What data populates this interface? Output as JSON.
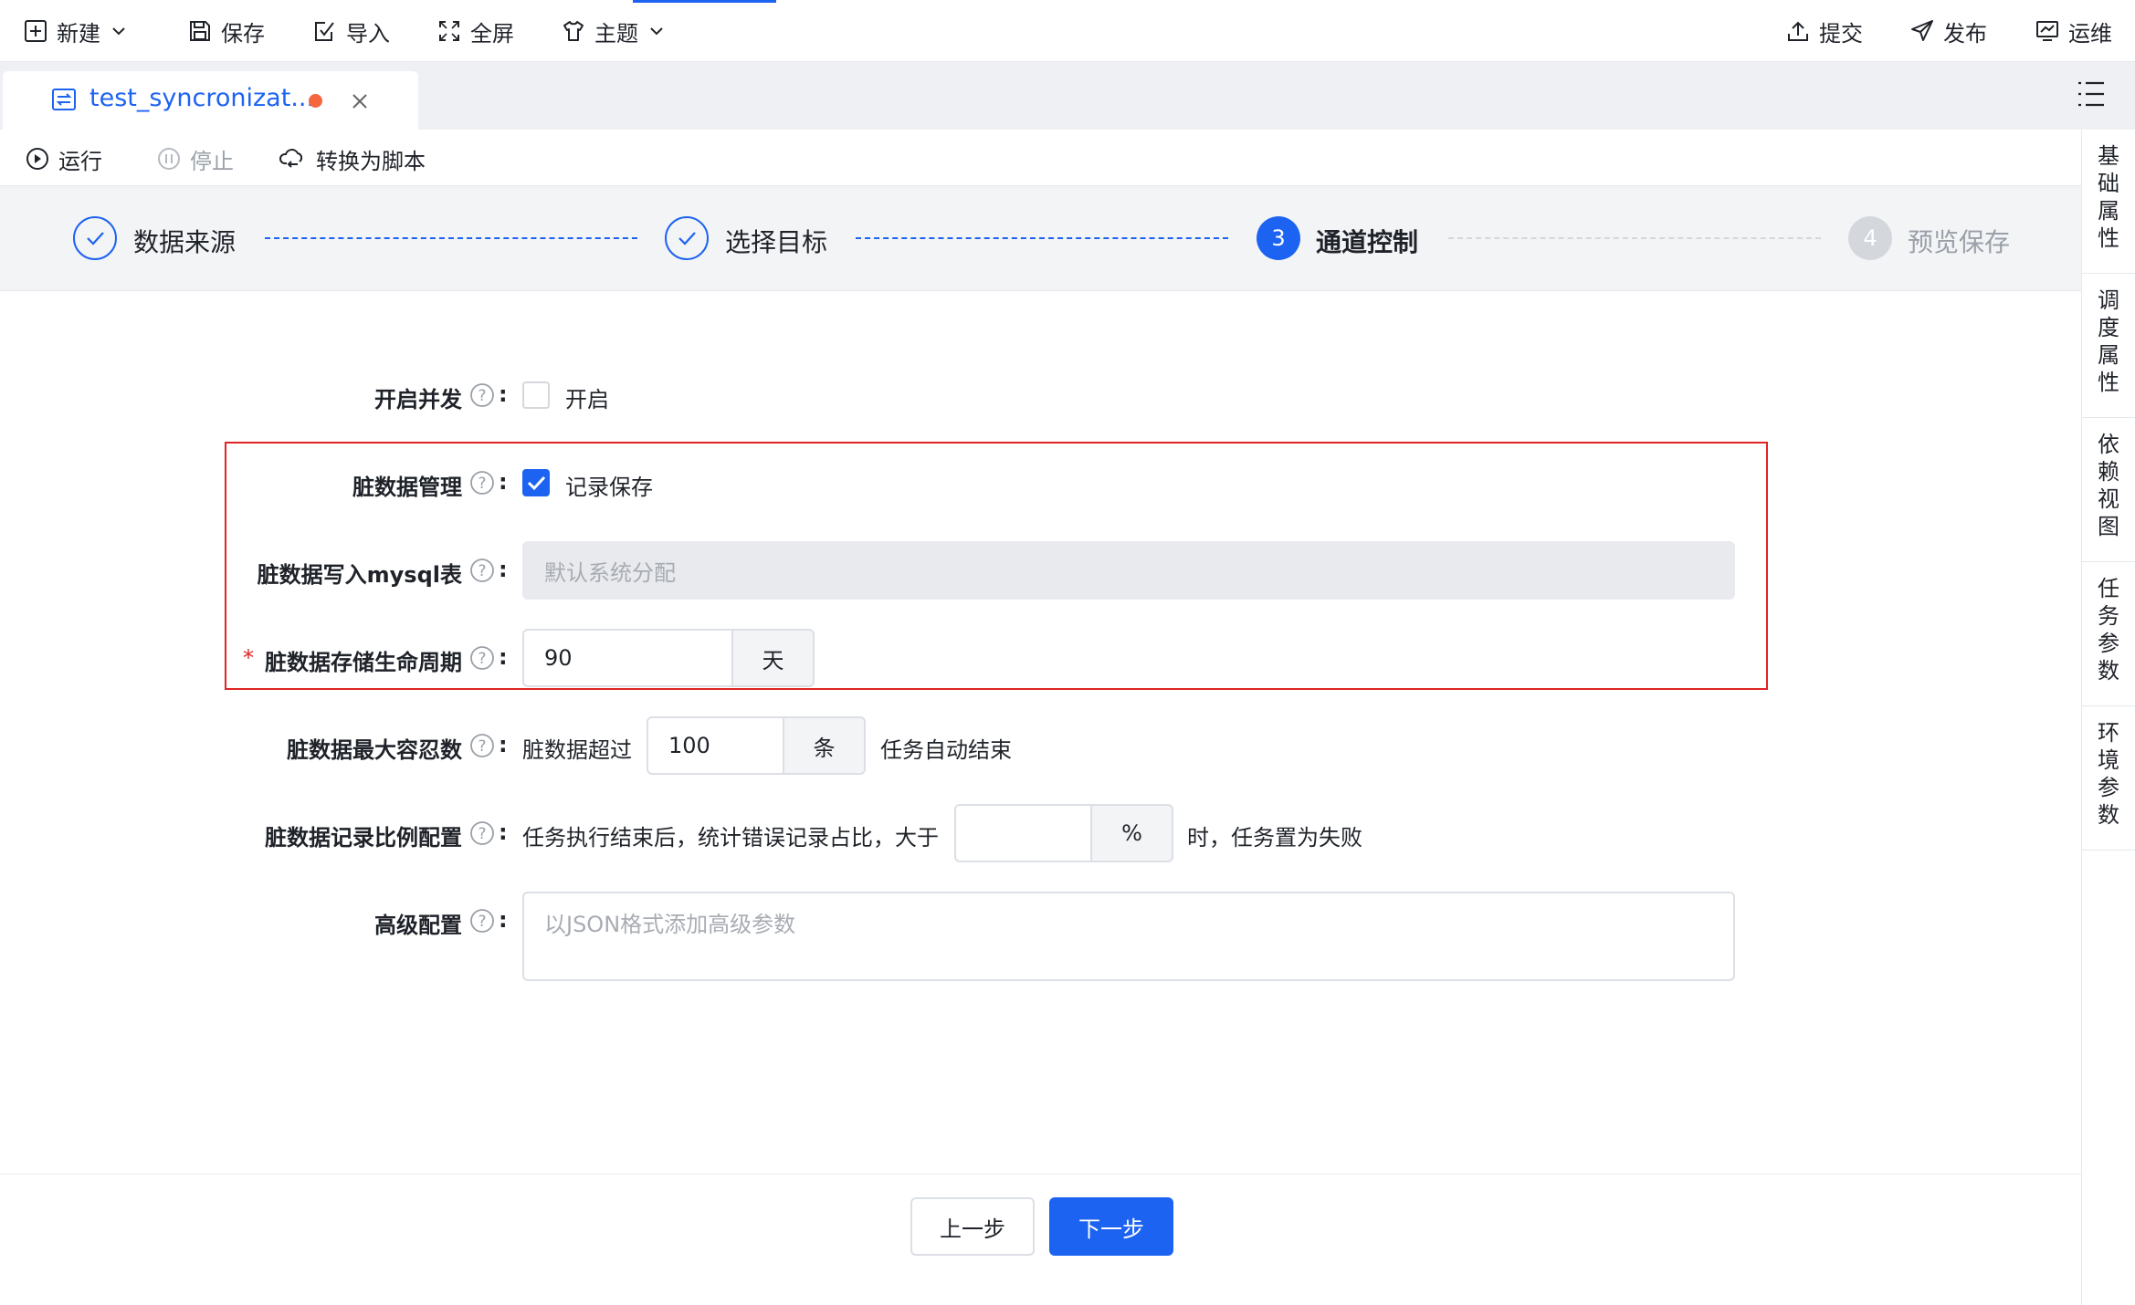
{
  "toolbar": {
    "new_label": "新建",
    "save_label": "保存",
    "import_label": "导入",
    "fullscreen_label": "全屏",
    "theme_label": "主题",
    "submit_label": "提交",
    "publish_label": "发布",
    "ops_label": "运维"
  },
  "tab": {
    "title": "test_syncronizat..."
  },
  "actions": {
    "run_label": "运行",
    "stop_label": "停止",
    "convert_label": "转换为脚本"
  },
  "steps": [
    {
      "number": "1",
      "label": "数据来源",
      "status": "done"
    },
    {
      "number": "2",
      "label": "选择目标",
      "status": "done"
    },
    {
      "number": "3",
      "label": "通道控制",
      "status": "active"
    },
    {
      "number": "4",
      "label": "预览保存",
      "status": "pending"
    }
  ],
  "right_rail": [
    {
      "label": "基础属性"
    },
    {
      "label": "调度属性"
    },
    {
      "label": "依赖视图"
    },
    {
      "label": "任务参数"
    },
    {
      "label": "环境参数"
    }
  ],
  "form": {
    "concurrency": {
      "label": "开启并发",
      "checkbox_label": "开启",
      "checked": false
    },
    "dirty_mgmt": {
      "label": "脏数据管理",
      "checkbox_label": "记录保存",
      "checked": true
    },
    "mysql_table": {
      "label": "脏数据写入mysql表",
      "placeholder": "默认系统分配"
    },
    "lifecycle": {
      "required_mark": "*",
      "label": "脏数据存储生命周期",
      "value": "90",
      "unit": "天"
    },
    "max_tolerance": {
      "label": "脏数据最大容忍数",
      "prefix": "脏数据超过",
      "value": "100",
      "unit": "条",
      "suffix": "任务自动结束"
    },
    "ratio": {
      "label": "脏数据记录比例配置",
      "prefix": "任务执行结束后，统计错误记录占比，大于",
      "value": "",
      "unit": "%",
      "suffix": "时，任务置为失败"
    },
    "advanced": {
      "label": "高级配置",
      "placeholder": "以JSON格式添加高级参数"
    }
  },
  "footer": {
    "prev_label": "上一步",
    "next_label": "下一步"
  },
  "colors": {
    "accent": "#1d63f2",
    "highlight_border": "#e02424",
    "unsaved_dot": "#f5663f"
  }
}
